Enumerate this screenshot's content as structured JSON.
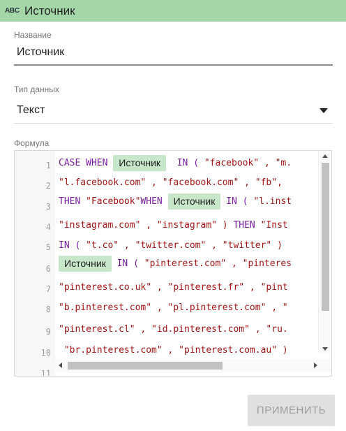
{
  "header": {
    "icon": "ABC",
    "title": "Источник",
    "bg_color": "#a5d6a7"
  },
  "name_field": {
    "label": "Название",
    "value": "Источник"
  },
  "type_field": {
    "label": "Тип данных",
    "value": "Текст"
  },
  "formula": {
    "label": "Формула",
    "line_numbers": [
      "1",
      "2",
      "3",
      "4",
      "5",
      "6",
      "7",
      "8",
      "9",
      "10",
      "11"
    ],
    "field_chip": "Источник",
    "tokens": {
      "l1_kw": "CASE WHEN ",
      "l1_in": "  IN ( ",
      "l1_str": "\"facebook\" , \"m.",
      "l2_str": "\"l.facebook.com\" , \"facebook.com\" , \"fb\",",
      "l3_then": "THEN ",
      "l3_str1": "\"Facebook\"",
      "l3_when": "WHEN ",
      "l3_in": " IN ( ",
      "l3_str2": "\"l.inst",
      "l4_str1": "\"instagram.com\" , \"instagram\" ) ",
      "l4_then": "THEN ",
      "l4_str2": "\"Inst",
      "l5_in": "IN ( ",
      "l5_str": "\"t.co\" , \"twitter.com\" , \"twitter\" ) ",
      "l6_in": " IN ( ",
      "l6_str": "\"pinterest.com\" , \"pinteres",
      "l7_str": "\"pinterest.co.uk\" , \"pinterest.fr\" , \"pint",
      "l8_str": "\"b.pinterest.com\" , \"pl.pinterest.com\" , \"",
      "l9_str": "\"pinterest.cl\" , \"id.pinterest.com\" , \"ru.",
      "l10_str": " \"br.pinterest.com\" , \"pinterest.com.au\" )"
    }
  },
  "apply_button": {
    "label": "ПРИМЕНИТЬ"
  }
}
